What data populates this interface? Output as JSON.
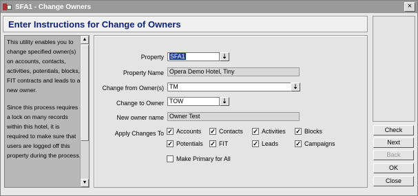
{
  "window": {
    "title": "SFA1 - Change Owners",
    "close_label": "×"
  },
  "header": {
    "title": "Enter Instructions for Change of Owners"
  },
  "instructions": {
    "paragraph1": "This utility enables you to change specified owner(s) on accounts, contacts, activities, potentials, blocks, FIT contracts and leads to a new owner.",
    "paragraph2": "Since this process requires a lock on many records within this hotel, it is required to make sure that users are logged off this property during the process."
  },
  "form": {
    "property_label": "Property",
    "property_value": "SFA1",
    "property_name_label": "Property Name",
    "property_name_value": "Opera Demo Hotel, Tiny",
    "change_from_label": "Change from Owner(s)",
    "change_from_value": "TM",
    "change_to_label": "Change to Owner",
    "change_to_value": "TOW",
    "new_owner_name_label": "New owner name",
    "new_owner_name_value": "Owner Test",
    "apply_changes_label": "Apply Changes To",
    "checkboxes": [
      {
        "label": "Accounts",
        "checked": true
      },
      {
        "label": "Contacts",
        "checked": true
      },
      {
        "label": "Activities",
        "checked": true
      },
      {
        "label": "Blocks",
        "checked": true
      },
      {
        "label": "Potentials",
        "checked": true
      },
      {
        "label": "FIT",
        "checked": true
      },
      {
        "label": "Leads",
        "checked": true
      },
      {
        "label": "Campaigns",
        "checked": true
      }
    ],
    "make_primary_label": "Make Primary for All",
    "make_primary_checked": false
  },
  "buttons": {
    "check": "Check",
    "next": "Next",
    "back": "Back",
    "ok": "OK",
    "close": "Close"
  }
}
